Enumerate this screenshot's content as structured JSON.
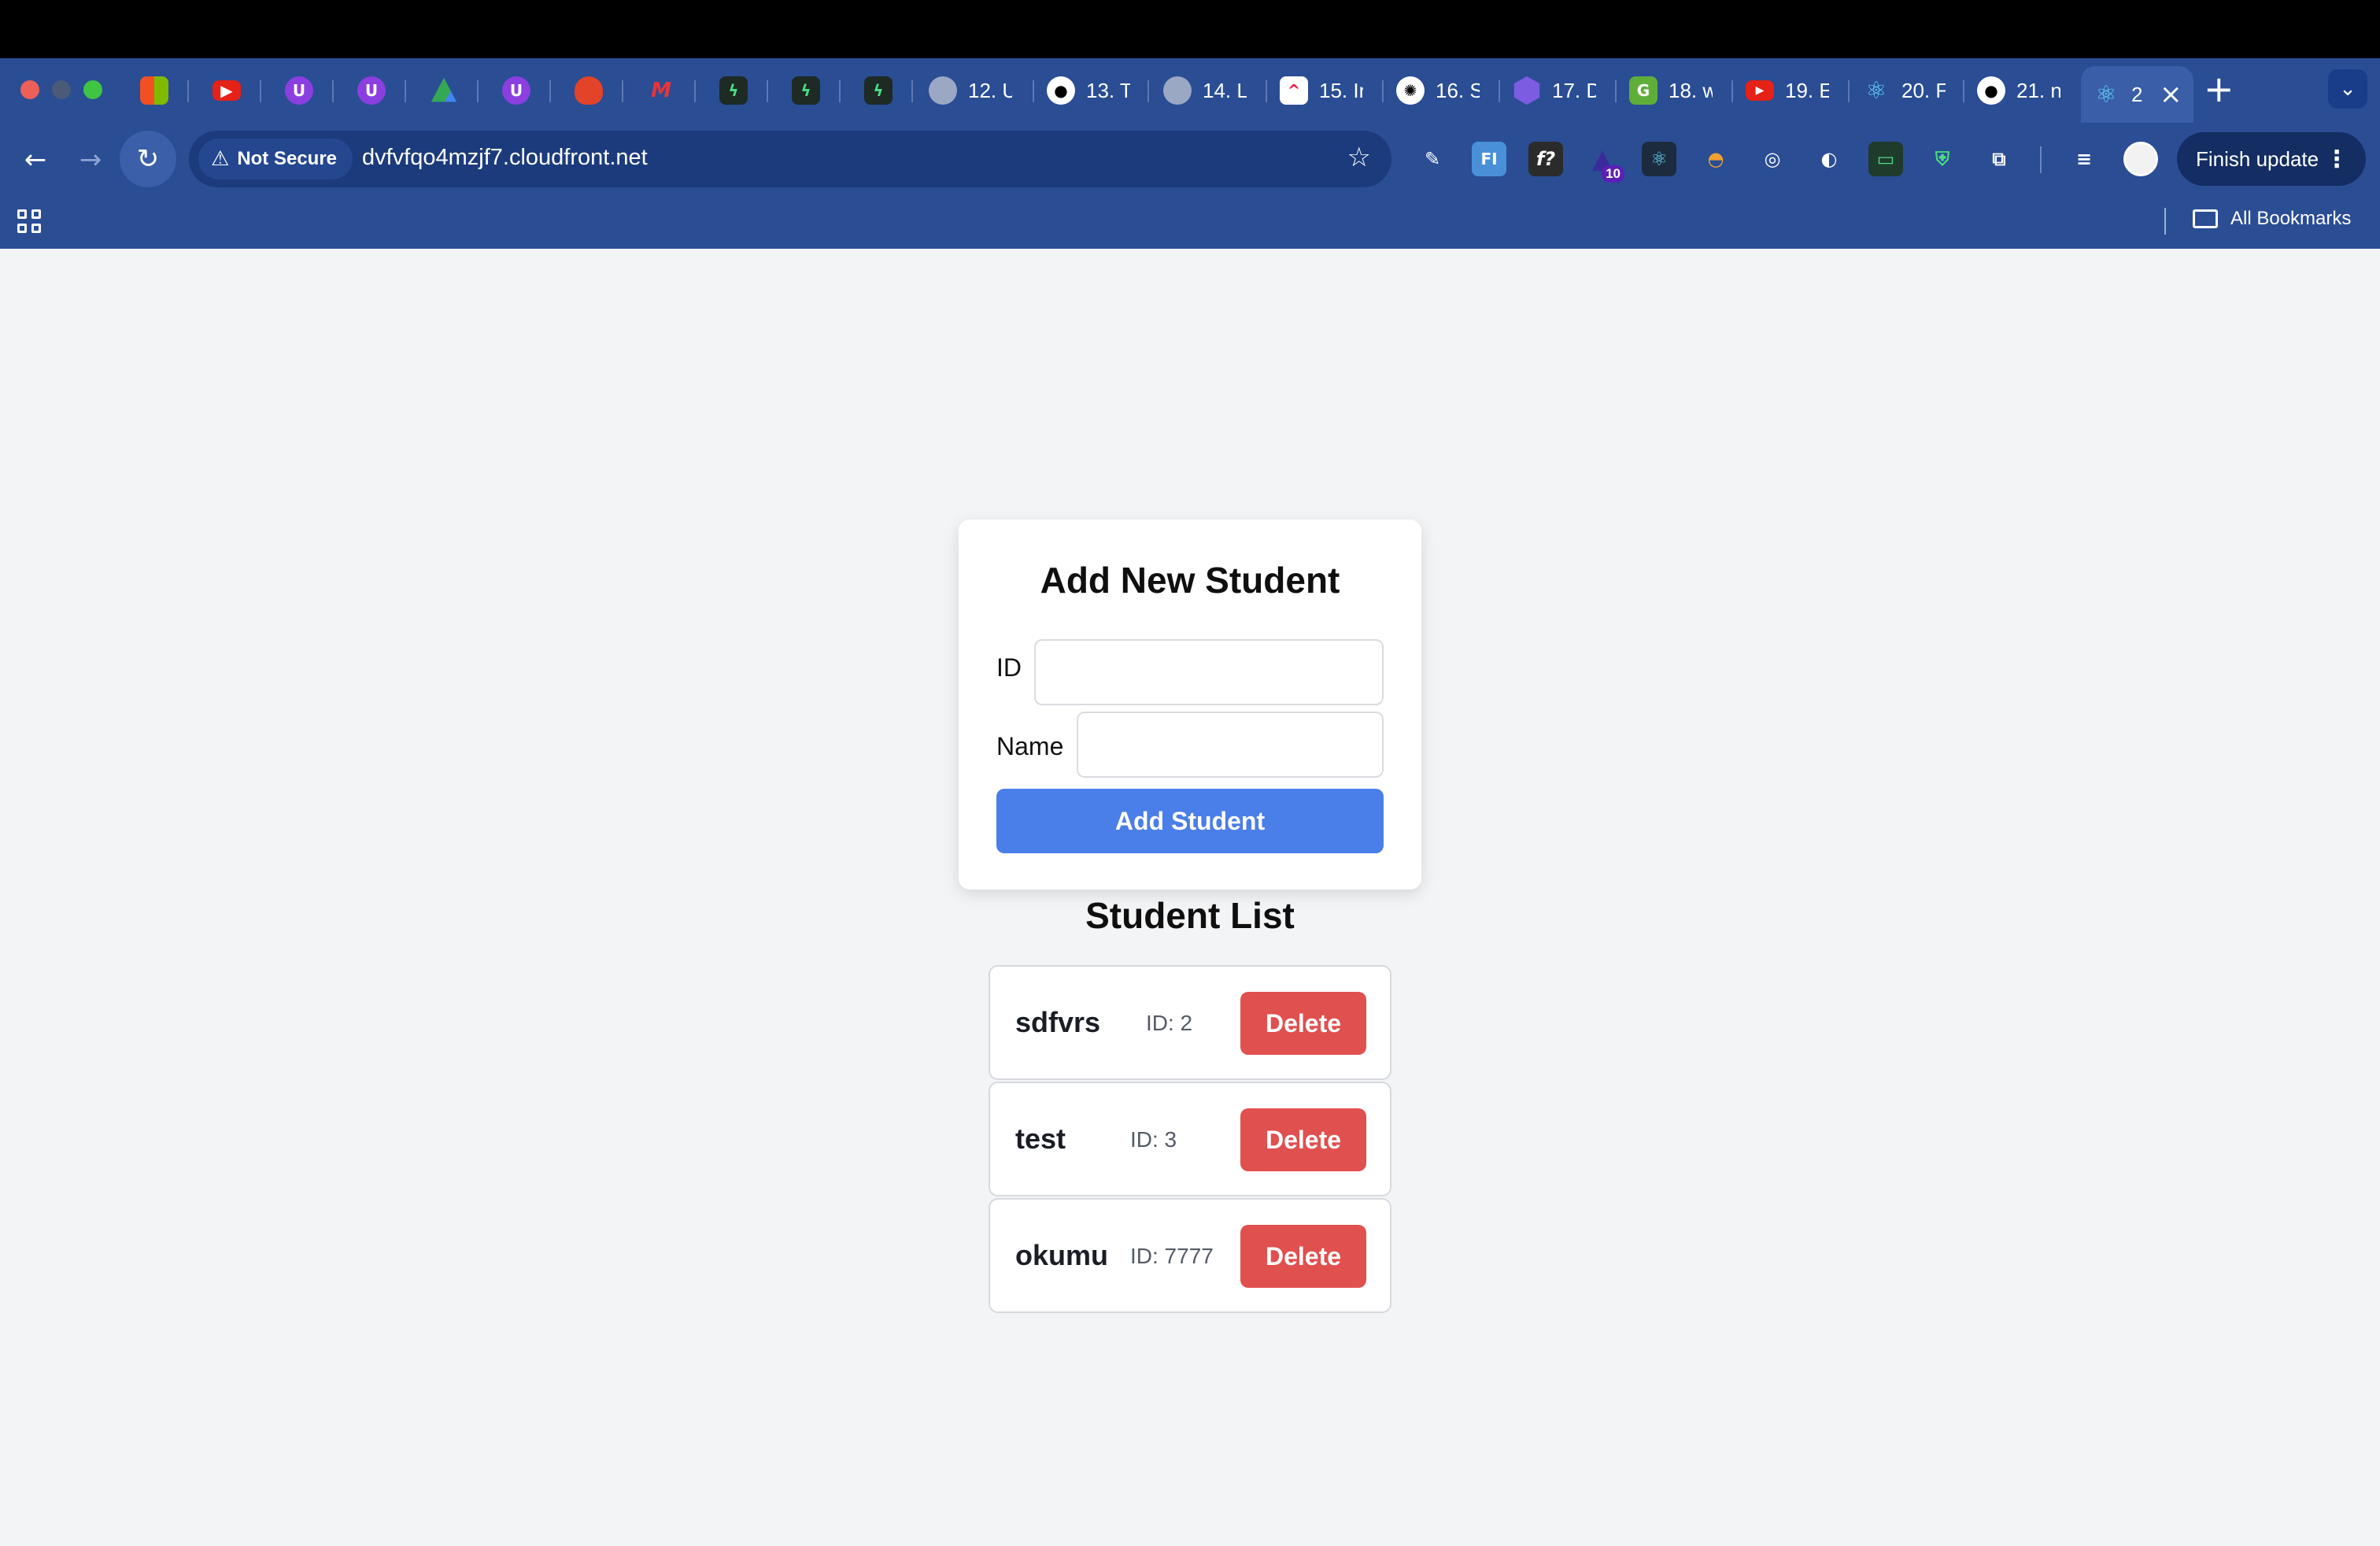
{
  "browser": {
    "tabs": [
      {
        "icon": "microsoft-icon",
        "title": ""
      },
      {
        "icon": "youtube-icon",
        "title": ""
      },
      {
        "icon": "udemy-icon",
        "title": ""
      },
      {
        "icon": "udemy-icon",
        "title": ""
      },
      {
        "icon": "google-drive-icon",
        "title": ""
      },
      {
        "icon": "udemy-icon",
        "title": ""
      },
      {
        "icon": "gitlab-icon",
        "title": ""
      },
      {
        "icon": "m-icon",
        "title": ""
      },
      {
        "icon": "bolt-icon",
        "title": ""
      },
      {
        "icon": "bolt-icon",
        "title": ""
      },
      {
        "icon": "bolt-icon",
        "title": ""
      },
      {
        "icon": "globe-icon",
        "title": "12. U"
      },
      {
        "icon": "github-icon",
        "title": "13. T"
      },
      {
        "icon": "globe-icon",
        "title": "14. L"
      },
      {
        "icon": "clickup-icon",
        "title": "15. Ir"
      },
      {
        "icon": "openai-icon",
        "title": "16. S"
      },
      {
        "icon": "hexagon-icon",
        "title": "17. D"
      },
      {
        "icon": "green-app-icon",
        "title": "18. w"
      },
      {
        "icon": "youtube-icon",
        "title": "19. E"
      },
      {
        "icon": "react-icon",
        "title": "20. F"
      },
      {
        "icon": "github-icon",
        "title": "21. n"
      },
      {
        "icon": "react-icon",
        "title": "2"
      }
    ],
    "security_label": "Not Secure",
    "url": "dvfvfqo4mzjf7.cloudfront.net",
    "extension_badge": "10",
    "finish_update_label": "Finish update",
    "all_bookmarks_label": "All Bookmarks"
  },
  "form": {
    "title": "Add New Student",
    "id_label": "ID",
    "name_label": "Name",
    "id_value": "",
    "name_value": "",
    "submit_label": "Add Student"
  },
  "list": {
    "title": "Student List",
    "delete_label": "Delete",
    "students": [
      {
        "name": "sdfvrs",
        "id_text": "ID: 2"
      },
      {
        "name": "test",
        "id_text": "ID: 3"
      },
      {
        "name": "okumu",
        "id_text": "ID: 7777"
      }
    ]
  },
  "colors": {
    "chrome_blue": "#2a4d94",
    "add_button": "#4a7ee8",
    "delete_button": "#e0504f",
    "page_background": "#f3f4f6"
  }
}
